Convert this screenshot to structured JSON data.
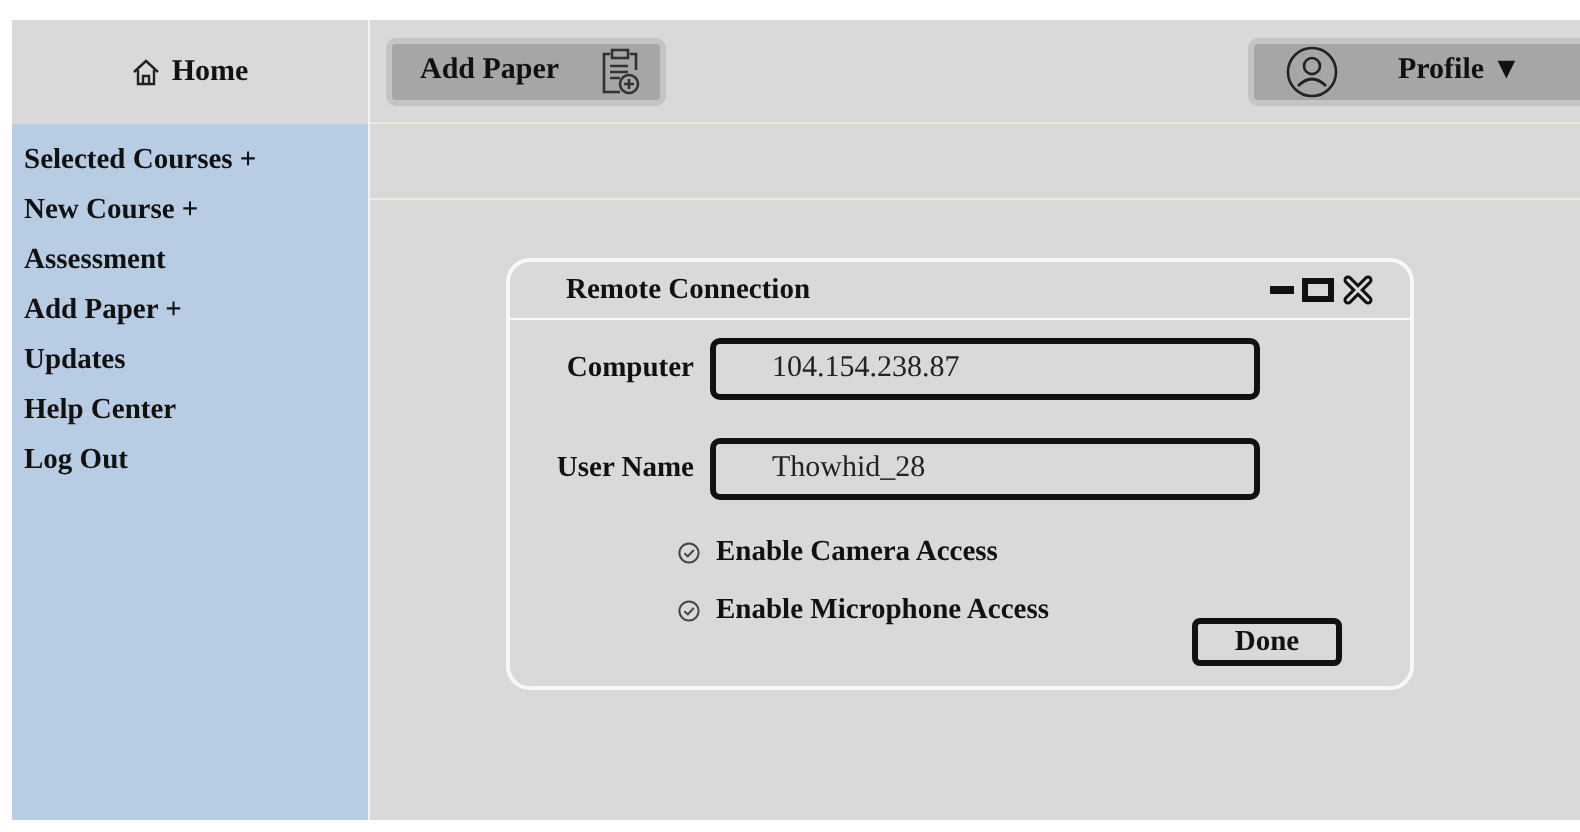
{
  "header": {
    "home": "Home",
    "add_paper": "Add Paper",
    "profile": "Profile ▼"
  },
  "sidebar": {
    "items": [
      {
        "label": "Selected Courses +"
      },
      {
        "label": "New Course +"
      },
      {
        "label": "Assessment"
      },
      {
        "label": "Add Paper +"
      },
      {
        "label": "Updates"
      },
      {
        "label": "Help Center"
      },
      {
        "label": "Log Out"
      }
    ]
  },
  "dialog": {
    "title": "Remote Connection",
    "fields": [
      {
        "label": "Computer",
        "value": "104.154.238.87"
      },
      {
        "label": "User Name",
        "value": "Thowhid_28"
      }
    ],
    "options": [
      {
        "label": "Enable Camera Access",
        "checked": true
      },
      {
        "label": "Enable Microphone Access",
        "checked": true
      }
    ],
    "button": "Done"
  }
}
